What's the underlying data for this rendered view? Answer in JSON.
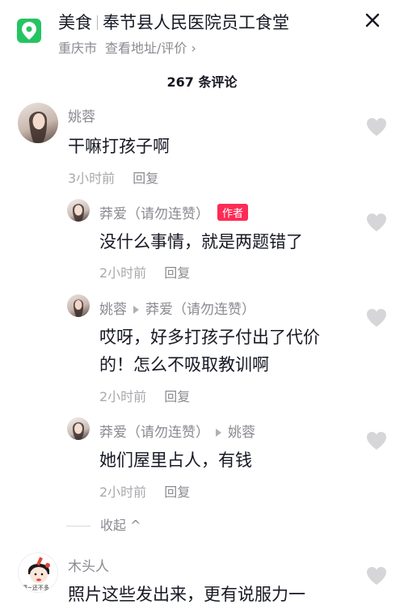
{
  "header": {
    "category": "美食",
    "place": "奉节县人民医院员工食堂",
    "city": "重庆市",
    "address_link": "查看地址/评价 ›"
  },
  "comments_count": "267 条评论",
  "comments": [
    {
      "name": "姚蓉",
      "text": "干嘛打孩子啊",
      "time": "3小时前",
      "reply": "回复"
    },
    {
      "name": "莽爱（请勿连赞）",
      "tag": "作者",
      "text": "没什么事情，就是两题错了",
      "time": "2小时前",
      "reply": "回复"
    },
    {
      "name": "姚蓉",
      "to": "莽爱（请勿连赞）",
      "text1": "哎呀，好多打孩子付出了代价",
      "text2": "的！怎么不吸取教训啊",
      "time": "2小时前",
      "reply": "回复"
    },
    {
      "name": "莽爱（请勿连赞）",
      "to": "姚蓉",
      "text": "她们屋里占人，有钱",
      "time": "2小时前",
      "reply": "回复"
    },
    {
      "name": "木头人",
      "text": "照片这些发出来，更有说服力一",
      "avatar_caption": "嗯~还不多"
    }
  ],
  "collapse_label": "收起 ^",
  "colors": {
    "accent": "#fe2c55",
    "location_green": "#25c462"
  },
  "icons": [
    "location-icon",
    "close-icon",
    "heart-icon",
    "triangle-arrow-icon"
  ]
}
